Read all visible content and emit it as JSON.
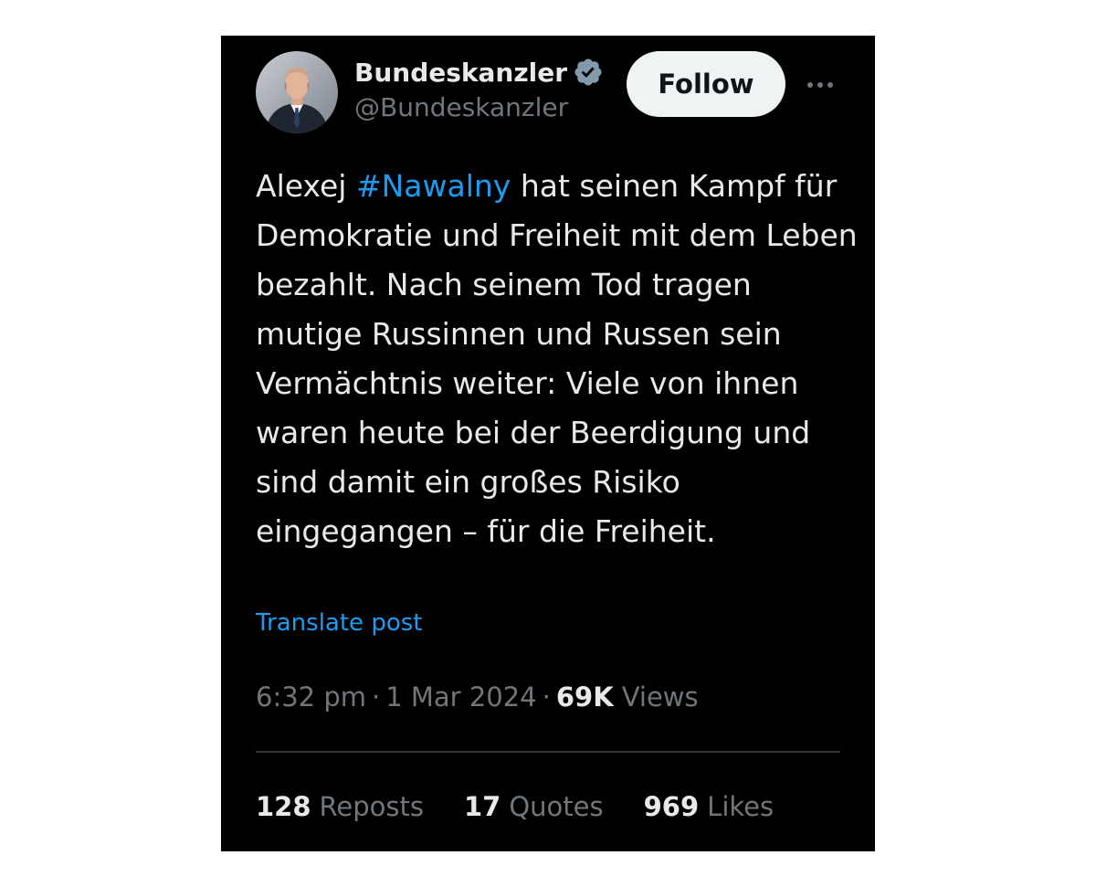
{
  "author": {
    "display_name": "Bundeskanzler",
    "handle": "@Bundeskanzler",
    "verified_icon": "verified-badge-icon"
  },
  "header": {
    "follow_label": "Follow",
    "more_icon": "more-options-icon"
  },
  "tweet": {
    "text_before_hashtag": "Alexej ",
    "hashtag": "#Nawalny",
    "text_after_hashtag": " hat seinen Kampf für Demokratie und Freiheit mit dem Leben bezahlt. Nach seinem Tod tragen mutige Russinnen und Russen sein Vermächtnis weiter: Viele von ihnen waren heute bei der Beerdigung und sind damit ein großes Risiko eingegangen – für die Freiheit.",
    "translate_label": "Translate post"
  },
  "meta": {
    "time": "6:32 pm",
    "date": "1 Mar 2024",
    "separator": "·",
    "views_count": "69K",
    "views_label": "Views"
  },
  "stats": [
    {
      "count": "128",
      "label": "Reposts"
    },
    {
      "count": "17",
      "label": "Quotes"
    },
    {
      "count": "969",
      "label": "Likes"
    }
  ],
  "colors": {
    "background": "#000000",
    "text_primary": "#e7e9ea",
    "text_secondary": "#71767b",
    "accent": "#1d9bf0",
    "follow_button_bg": "#eff3f4",
    "divider": "#2f3336"
  }
}
